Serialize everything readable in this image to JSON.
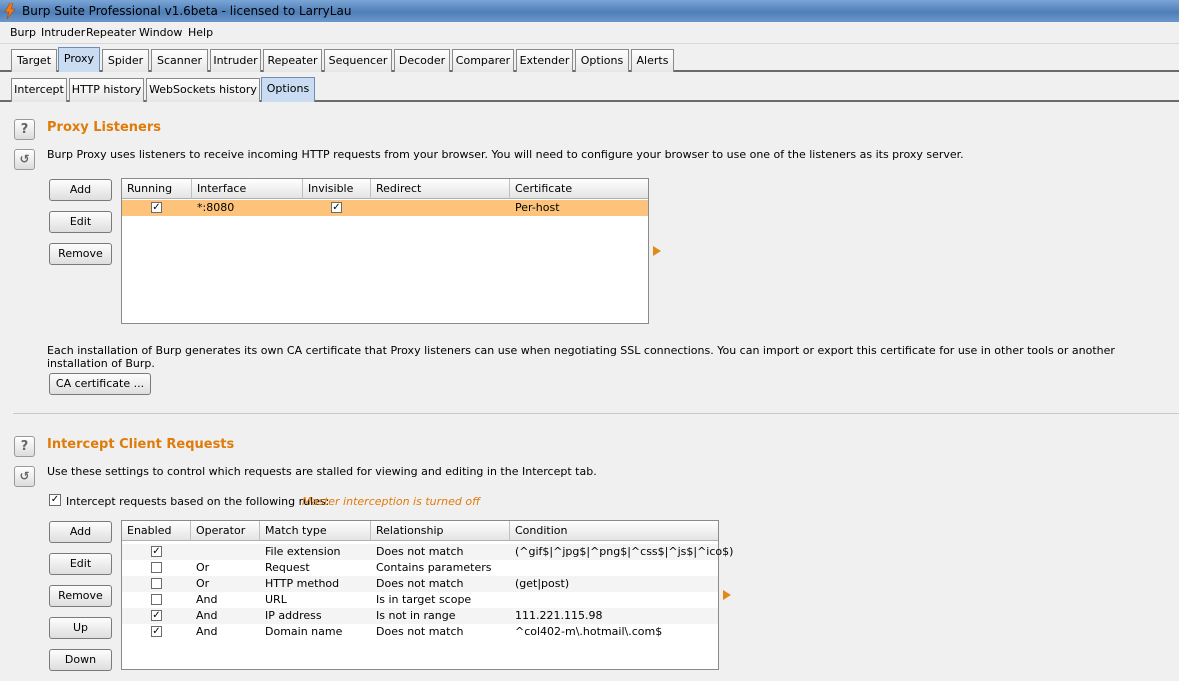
{
  "window": {
    "title": "Burp Suite Professional v1.6beta - licensed to LarryLau"
  },
  "menu": [
    "Burp",
    "Intruder",
    "Repeater",
    "Window",
    "Help"
  ],
  "main_tabs": [
    "Target",
    "Proxy",
    "Spider",
    "Scanner",
    "Intruder",
    "Repeater",
    "Sequencer",
    "Decoder",
    "Comparer",
    "Extender",
    "Options",
    "Alerts"
  ],
  "sub_tabs": [
    "Intercept",
    "HTTP history",
    "WebSockets history",
    "Options"
  ],
  "proxy_listeners": {
    "title": "Proxy Listeners",
    "description": "Burp Proxy uses listeners to receive incoming HTTP requests from your browser. You will need to configure your browser to use one of the listeners as its proxy server.",
    "buttons": [
      "Add",
      "Edit",
      "Remove"
    ],
    "columns": [
      "Running",
      "Interface",
      "Invisible",
      "Redirect",
      "Certificate"
    ],
    "rows": [
      {
        "running": "✓",
        "interface": "*:8080",
        "invisible": "✓",
        "redirect": "",
        "certificate": "Per-host"
      }
    ],
    "ca_text": "Each installation of Burp generates its own CA certificate that Proxy listeners can use when negotiating SSL connections. You can import or export this certificate for use in other tools or another installation of Burp.",
    "ca_button": "CA certificate ..."
  },
  "intercept_client": {
    "title": "Intercept Client Requests",
    "description": "Use these settings to control which requests are stalled for viewing and editing in the Intercept tab.",
    "checkbox_label": "Intercept requests based on the following rules:",
    "checkbox_checked": "✓",
    "master_status": "Master interception is turned off",
    "buttons": [
      "Add",
      "Edit",
      "Remove",
      "Up",
      "Down"
    ],
    "columns": [
      "Enabled",
      "Operator",
      "Match type",
      "Relationship",
      "Condition"
    ],
    "rows": [
      {
        "enabled": "✓",
        "operator": "",
        "match_type": "File extension",
        "relationship": "Does not match",
        "condition": "(^gif$|^jpg$|^png$|^css$|^js$|^ico$)"
      },
      {
        "enabled": "",
        "operator": "Or",
        "match_type": "Request",
        "relationship": "Contains parameters",
        "condition": ""
      },
      {
        "enabled": "",
        "operator": "Or",
        "match_type": "HTTP method",
        "relationship": "Does not match",
        "condition": "(get|post)"
      },
      {
        "enabled": "",
        "operator": "And",
        "match_type": "URL",
        "relationship": "Is in target scope",
        "condition": ""
      },
      {
        "enabled": "✓",
        "operator": "And",
        "match_type": "IP address",
        "relationship": "Is not in range",
        "condition": "111.221.115.98"
      },
      {
        "enabled": "✓",
        "operator": "And",
        "match_type": "Domain name",
        "relationship": "Does not match",
        "condition": "^col402-m\\.hotmail\\.com$"
      }
    ]
  },
  "icons": {
    "help": "?",
    "reload": "↺"
  }
}
